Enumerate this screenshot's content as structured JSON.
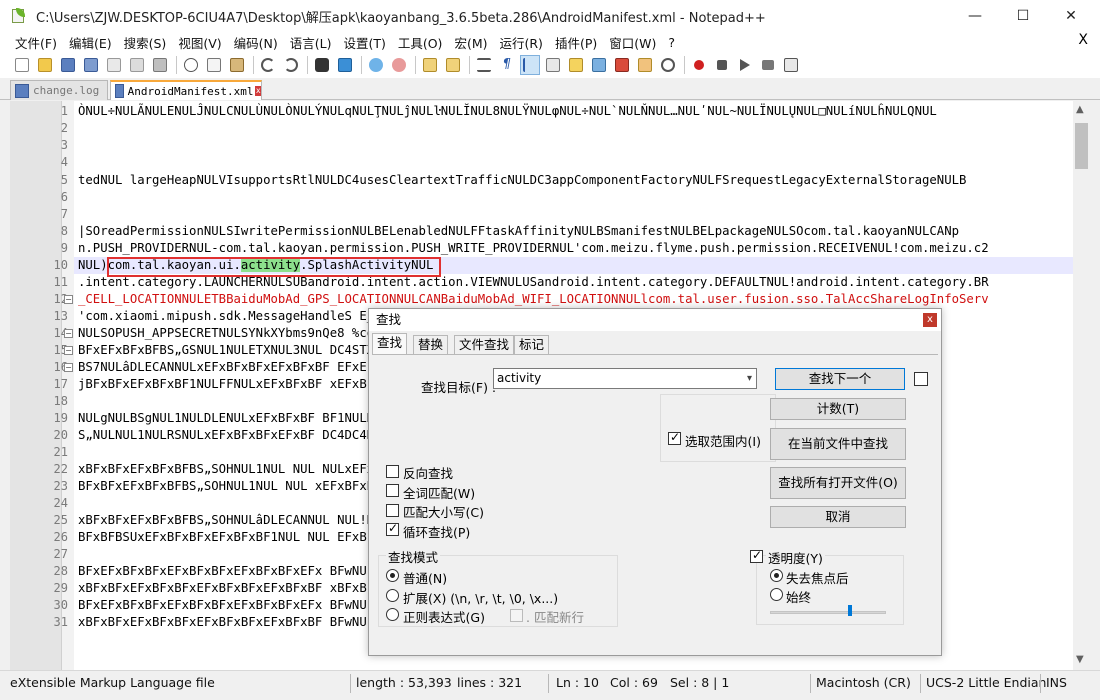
{
  "window": {
    "title": "C:\\Users\\ZJW.DESKTOP-6CIU4A7\\Desktop\\解压apk\\kaoyanbang_3.6.5beta.286\\AndroidManifest.xml - Notepad++",
    "min_glyph": "—",
    "max_glyph": "☐",
    "close_glyph": "✕"
  },
  "menu": {
    "items": [
      "文件(F)",
      "编辑(E)",
      "搜索(S)",
      "视图(V)",
      "编码(N)",
      "语言(L)",
      "设置(T)",
      "工具(O)",
      "宏(M)",
      "运行(R)",
      "插件(P)",
      "窗口(W)",
      "?"
    ],
    "close_glyph": "X"
  },
  "tabs": [
    {
      "label": "change.log"
    },
    {
      "label": "AndroidManifest.xml",
      "active": true,
      "close_glyph": "x"
    }
  ],
  "editor": {
    "current_line": 10,
    "lines": [
      {
        "n": "1",
        "text": "ÒNUL÷NULÃNULENULĴNULCNULÙNULÒNULÝNULqNULŢNULĵNULŀNULĬNUL8NULŸNULφNUL÷NUL`NULŇNUL…NULʹNUL~NULÏNULŲNUL□NULíNULĥNULQNUL"
      },
      {
        "n": "2",
        "text": ""
      },
      {
        "n": "3",
        "text": ""
      },
      {
        "n": "4",
        "text": ""
      },
      {
        "n": "5",
        "text": "tedNUL  largeHeapNULVIsupportsRtlNULDC4usesCleartextTrafficNULDC3appComponentFactoryNULFSrequestLegacyExternalStorageNULB"
      },
      {
        "n": "6",
        "text": ""
      },
      {
        "n": "7",
        "text": ""
      },
      {
        "n": "8",
        "text": "|SOreadPermissionNULSIwritePermissionNULBELenabledNULFFtaskAffinityNULBSmanifestNULBELpackageNULSOcom.tal.kaoyanNULCANp"
      },
      {
        "n": "9",
        "text": "n.PUSH_PROVIDERNUL-com.tal.kaoyan.permission.PUSH_WRITE_PROVIDERNUL'com.meizu.flyme.push.permission.RECEIVENUL!com.meizu.c2"
      },
      {
        "n": "10",
        "text": "NUL)com.tal.kaoyan.ui.activity.SplashActivityNUL",
        "match_pre": "NUL)com.tal.kaoyan.ui.",
        "match": "activity",
        "match_post": ".SplashActivityNUL"
      },
      {
        "n": "11",
        "text": ".intent.category.LAUNCHERNULSUBandroid.intent.action.VIEWNULUSandroid.intent.category.DEFAULTNUL!android.intent.category.BR"
      },
      {
        "n": "12",
        "text": "_CELL_LOCATIONNULETBBaiduMobAd_GPS_LOCATIONNULCANBaiduMobAd_WIFI_LOCATIONNULlcom.tal.user.fusion.sso.TalAccShareLogInfoServ"
      },
      {
        "n": "13",
        "text": "'com.xiaomi.mipush.sdk.MessageHandleS                                                          E_MESSAGENUL!com"
      },
      {
        "n": "14",
        "text": "NULSOPUSH_APPSECRETNULSYNkXYbms9nQe8                                                              %com.igexin.sdk."
      },
      {
        "n": "15",
        "text": "BFxEFxBFxBFBS„GSNUL1NULETXNUL3NUL                                                             DC4STXNULNULNUL"
      },
      {
        "n": "16",
        "text": "BS7NULâDLECANNULxEFxBFxBFxEFxBFxBF                                                            EFxEFxBFxBFxEFxBF"
      },
      {
        "n": "17",
        "text": "jBFxBFxEFxBFxBF1NULFFNULxEFxBFxBF                                                              xEFxBFxBFxEFxBFxB"
      },
      {
        "n": "18",
        "text": ""
      },
      {
        "n": "19",
        "text": "NULgNULBSgNUL1NULDLENULxEFxBFxBF                                                               BF1NULDC2NULxEF"
      },
      {
        "n": "20",
        "text": "S„NULNUL1NULRSNULxEFxBFxBFxEFxBF                                                              DC4DC4NULNULNUL"
      },
      {
        "n": "21",
        "text": ""
      },
      {
        "n": "22",
        "text": "xBFxBFxEFxBFxBFBS„SOHNUL1NUL  NUL                                                             NULxEFxBFxBFxEFx"
      },
      {
        "n": "23",
        "text": "BFxBFxEFxBFxBFBS„SOHNUL1NUL  NUL                                                              xEFxBFxBFâDLECA"
      },
      {
        "n": "24",
        "text": ""
      },
      {
        "n": "25",
        "text": "xBFxBFxEFxBFxBFBS„SOHNULâDLECANNUL                                                           NUL!NULxEFxBFxBFxE"
      },
      {
        "n": "26",
        "text": "BFxBFBSUxEFxBFxBFxEFxBFxBF1NUL  NUL                                                           EFxBFxBFxEFxBFxB"
      },
      {
        "n": "27",
        "text": ""
      },
      {
        "n": "28",
        "text": "BFxEFxBFxBFxEFxBFxBFxEFxBFxBFxEFx                                                             BFwNULDC4DC4ET"
      },
      {
        "n": "29",
        "text": "xBFxBFxEFxBFxBFxEFxBFxBFxEFxBFxBF                                                             xBFxBFxEFxBFxBF"
      },
      {
        "n": "30",
        "text": "BFxEFxBFxBFxEFxBFxBFxEFxBFxBFxEFx                                                             BFwNULDC4DC4ET"
      },
      {
        "n": "31",
        "text": "xBFxBFxEFxBFxBFxEFxBFxBFxEFxBFxBF                                                             BFwNULDC4DC4ETX"
      }
    ]
  },
  "status": {
    "filetype": "eXtensible Markup Language file",
    "length": "length : 53,393",
    "lines": "lines : 321",
    "ln": "Ln : 10",
    "col": "Col : 69",
    "sel": "Sel : 8 | 1",
    "eol": "Macintosh (CR)",
    "encoding": "UCS-2 Little Endian",
    "mode": "INS"
  },
  "find_dialog": {
    "title": "查找",
    "close_glyph": "x",
    "tabs": [
      "查找",
      "替换",
      "文件查找",
      "标记"
    ],
    "find_label": "查找目标(F) :",
    "find_value": "activity",
    "buttons": {
      "find_next": "查找下一个",
      "count": "计数(T)",
      "find_all_current": "在当前文件中查找",
      "find_all_open": "查找所有打开文件(O)",
      "cancel": "取消"
    },
    "in_selection": {
      "label": "选取范围内(I)",
      "checked": true
    },
    "options": [
      {
        "label": "反向查找",
        "checked": false
      },
      {
        "label": "全词匹配(W)",
        "checked": false
      },
      {
        "label": "匹配大小写(C)",
        "checked": false
      },
      {
        "label": "循环查找(P)",
        "checked": true
      }
    ],
    "search_mode": {
      "title": "查找模式",
      "options": [
        {
          "label": "普通(N)",
          "selected": true
        },
        {
          "label": "扩展(X) (\\n, \\r, \\t, \\0, \\x...)",
          "selected": false
        },
        {
          "label": "正则表达式(G)",
          "selected": false
        }
      ],
      "dotall_label": ". 匹配新行"
    },
    "transparency": {
      "label": "透明度(Y)",
      "checked": true,
      "options": [
        {
          "label": "失去焦点后",
          "selected": true
        },
        {
          "label": "始终",
          "selected": false
        }
      ],
      "level": 0.7
    }
  }
}
